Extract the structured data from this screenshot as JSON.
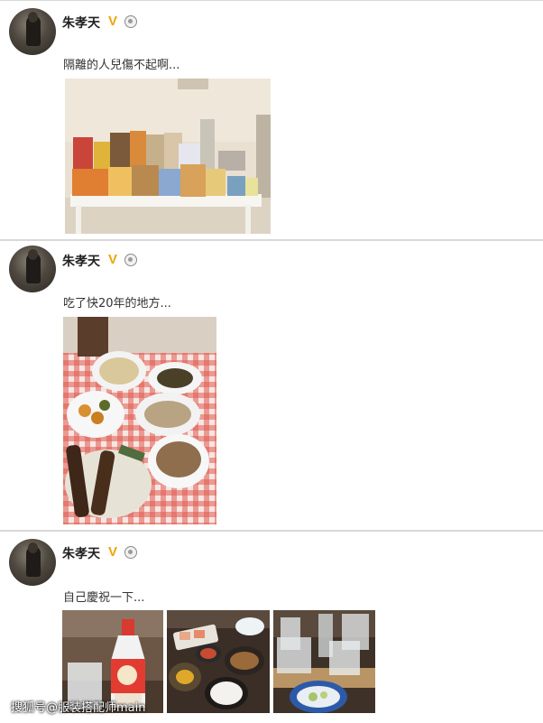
{
  "posts": [
    {
      "author": "朱孝天",
      "text": "隔離的人兒傷不起啊..."
    },
    {
      "author": "朱孝天",
      "text": "吃了快20年的地方..."
    },
    {
      "author": "朱孝天",
      "text": "自己慶祝一下..."
    }
  ],
  "badges": {
    "verified": "V"
  },
  "watermark": "搜狐号@服装搭配师main"
}
